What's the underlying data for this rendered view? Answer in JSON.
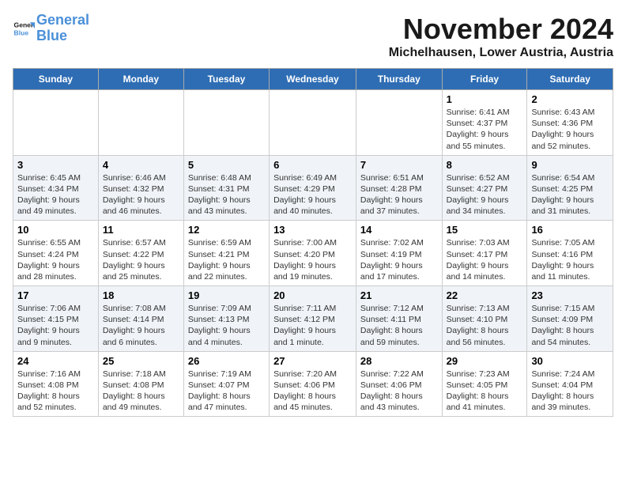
{
  "header": {
    "logo_line1": "General",
    "logo_line2": "Blue",
    "month": "November 2024",
    "location": "Michelhausen, Lower Austria, Austria"
  },
  "days_of_week": [
    "Sunday",
    "Monday",
    "Tuesday",
    "Wednesday",
    "Thursday",
    "Friday",
    "Saturday"
  ],
  "weeks": [
    [
      {
        "day": "",
        "info": ""
      },
      {
        "day": "",
        "info": ""
      },
      {
        "day": "",
        "info": ""
      },
      {
        "day": "",
        "info": ""
      },
      {
        "day": "",
        "info": ""
      },
      {
        "day": "1",
        "info": "Sunrise: 6:41 AM\nSunset: 4:37 PM\nDaylight: 9 hours and 55 minutes."
      },
      {
        "day": "2",
        "info": "Sunrise: 6:43 AM\nSunset: 4:36 PM\nDaylight: 9 hours and 52 minutes."
      }
    ],
    [
      {
        "day": "3",
        "info": "Sunrise: 6:45 AM\nSunset: 4:34 PM\nDaylight: 9 hours and 49 minutes."
      },
      {
        "day": "4",
        "info": "Sunrise: 6:46 AM\nSunset: 4:32 PM\nDaylight: 9 hours and 46 minutes."
      },
      {
        "day": "5",
        "info": "Sunrise: 6:48 AM\nSunset: 4:31 PM\nDaylight: 9 hours and 43 minutes."
      },
      {
        "day": "6",
        "info": "Sunrise: 6:49 AM\nSunset: 4:29 PM\nDaylight: 9 hours and 40 minutes."
      },
      {
        "day": "7",
        "info": "Sunrise: 6:51 AM\nSunset: 4:28 PM\nDaylight: 9 hours and 37 minutes."
      },
      {
        "day": "8",
        "info": "Sunrise: 6:52 AM\nSunset: 4:27 PM\nDaylight: 9 hours and 34 minutes."
      },
      {
        "day": "9",
        "info": "Sunrise: 6:54 AM\nSunset: 4:25 PM\nDaylight: 9 hours and 31 minutes."
      }
    ],
    [
      {
        "day": "10",
        "info": "Sunrise: 6:55 AM\nSunset: 4:24 PM\nDaylight: 9 hours and 28 minutes."
      },
      {
        "day": "11",
        "info": "Sunrise: 6:57 AM\nSunset: 4:22 PM\nDaylight: 9 hours and 25 minutes."
      },
      {
        "day": "12",
        "info": "Sunrise: 6:59 AM\nSunset: 4:21 PM\nDaylight: 9 hours and 22 minutes."
      },
      {
        "day": "13",
        "info": "Sunrise: 7:00 AM\nSunset: 4:20 PM\nDaylight: 9 hours and 19 minutes."
      },
      {
        "day": "14",
        "info": "Sunrise: 7:02 AM\nSunset: 4:19 PM\nDaylight: 9 hours and 17 minutes."
      },
      {
        "day": "15",
        "info": "Sunrise: 7:03 AM\nSunset: 4:17 PM\nDaylight: 9 hours and 14 minutes."
      },
      {
        "day": "16",
        "info": "Sunrise: 7:05 AM\nSunset: 4:16 PM\nDaylight: 9 hours and 11 minutes."
      }
    ],
    [
      {
        "day": "17",
        "info": "Sunrise: 7:06 AM\nSunset: 4:15 PM\nDaylight: 9 hours and 9 minutes."
      },
      {
        "day": "18",
        "info": "Sunrise: 7:08 AM\nSunset: 4:14 PM\nDaylight: 9 hours and 6 minutes."
      },
      {
        "day": "19",
        "info": "Sunrise: 7:09 AM\nSunset: 4:13 PM\nDaylight: 9 hours and 4 minutes."
      },
      {
        "day": "20",
        "info": "Sunrise: 7:11 AM\nSunset: 4:12 PM\nDaylight: 9 hours and 1 minute."
      },
      {
        "day": "21",
        "info": "Sunrise: 7:12 AM\nSunset: 4:11 PM\nDaylight: 8 hours and 59 minutes."
      },
      {
        "day": "22",
        "info": "Sunrise: 7:13 AM\nSunset: 4:10 PM\nDaylight: 8 hours and 56 minutes."
      },
      {
        "day": "23",
        "info": "Sunrise: 7:15 AM\nSunset: 4:09 PM\nDaylight: 8 hours and 54 minutes."
      }
    ],
    [
      {
        "day": "24",
        "info": "Sunrise: 7:16 AM\nSunset: 4:08 PM\nDaylight: 8 hours and 52 minutes."
      },
      {
        "day": "25",
        "info": "Sunrise: 7:18 AM\nSunset: 4:08 PM\nDaylight: 8 hours and 49 minutes."
      },
      {
        "day": "26",
        "info": "Sunrise: 7:19 AM\nSunset: 4:07 PM\nDaylight: 8 hours and 47 minutes."
      },
      {
        "day": "27",
        "info": "Sunrise: 7:20 AM\nSunset: 4:06 PM\nDaylight: 8 hours and 45 minutes."
      },
      {
        "day": "28",
        "info": "Sunrise: 7:22 AM\nSunset: 4:06 PM\nDaylight: 8 hours and 43 minutes."
      },
      {
        "day": "29",
        "info": "Sunrise: 7:23 AM\nSunset: 4:05 PM\nDaylight: 8 hours and 41 minutes."
      },
      {
        "day": "30",
        "info": "Sunrise: 7:24 AM\nSunset: 4:04 PM\nDaylight: 8 hours and 39 minutes."
      }
    ]
  ]
}
